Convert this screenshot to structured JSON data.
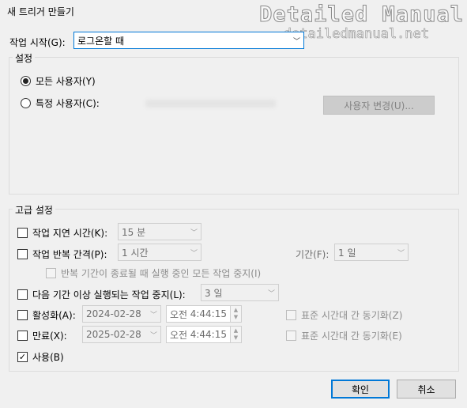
{
  "window": {
    "title": "새 트리거 만들기"
  },
  "watermark": {
    "line1": "Detailed Manual",
    "line2": "detailedmanual.net"
  },
  "start": {
    "label": "작업 시작(G):",
    "value": "로그온할 때"
  },
  "settings": {
    "legend": "설정",
    "all_users": "모든 사용자(Y)",
    "specific_user": "특정 사용자(C):",
    "change_user_button": "사용자 변경(U)..."
  },
  "advanced": {
    "legend": "고급 설정",
    "delay": {
      "label": "작업 지연 시간(K):",
      "value": "15 분"
    },
    "repeat": {
      "label": "작업 반복 간격(P):",
      "value": "1 시간",
      "duration_label": "기간(F):",
      "duration_value": "1 일"
    },
    "stop_repeat": {
      "label": "반복 기간이 종료될 때 실행 중인 모든 작업 중지(I)"
    },
    "stop_longer": {
      "label": "다음 기간 이상 실행되는 작업 중지(L):",
      "value": "3 일"
    },
    "activate": {
      "label": "활성화(A):",
      "date": "2024-02-28",
      "ampm": "오전",
      "time": "4:44:15",
      "sync": "표준 시간대 간 동기화(Z)"
    },
    "expire": {
      "label": "만료(X):",
      "date": "2025-02-28",
      "ampm": "오전",
      "time": "4:44:15",
      "sync": "표준 시간대 간 동기화(E)"
    },
    "enabled": {
      "label": "사용(B)",
      "check": "✓"
    }
  },
  "buttons": {
    "ok": "확인",
    "cancel": "취소"
  },
  "glyphs": {
    "chevron": "﹀",
    "up": "▲",
    "down": "▼"
  }
}
